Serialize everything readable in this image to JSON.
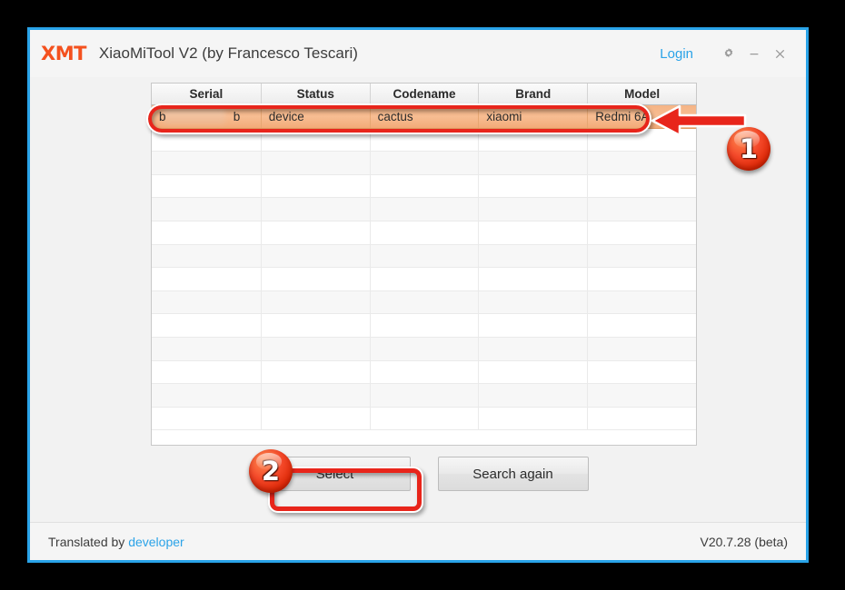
{
  "window": {
    "brand_logo": "XMT",
    "title": "XiaoMiTool V2 (by Francesco Tescari)",
    "login_label": "Login",
    "controls": {
      "settings": "gear-icon",
      "minimize": "minimize-icon",
      "close": "close-icon"
    },
    "accent_border_color": "#29a3e8",
    "brand_color": "#f4511e",
    "link_color": "#2ba3e8"
  },
  "table": {
    "columns": [
      "Serial",
      "Status",
      "Codename",
      "Brand",
      "Model"
    ],
    "rows": [
      {
        "serial": "b",
        "serial_suffix": "b",
        "serial_redacted": true,
        "status": "device",
        "codename": "cactus",
        "brand": "xiaomi",
        "model": "Redmi 6A",
        "selected": true
      }
    ],
    "empty_row_count": 13,
    "selected_row_color": "#f5b485"
  },
  "buttons": {
    "select_label": "Select",
    "search_again_label": "Search again"
  },
  "footer": {
    "translated_by_prefix": "Translated by ",
    "translator_label": "developer",
    "version": "V20.7.28 (beta)"
  },
  "annotations": {
    "badge_one": "1",
    "badge_two": "2",
    "arrow": "left-arrow-icon",
    "highlight_color": "#e8251b"
  }
}
